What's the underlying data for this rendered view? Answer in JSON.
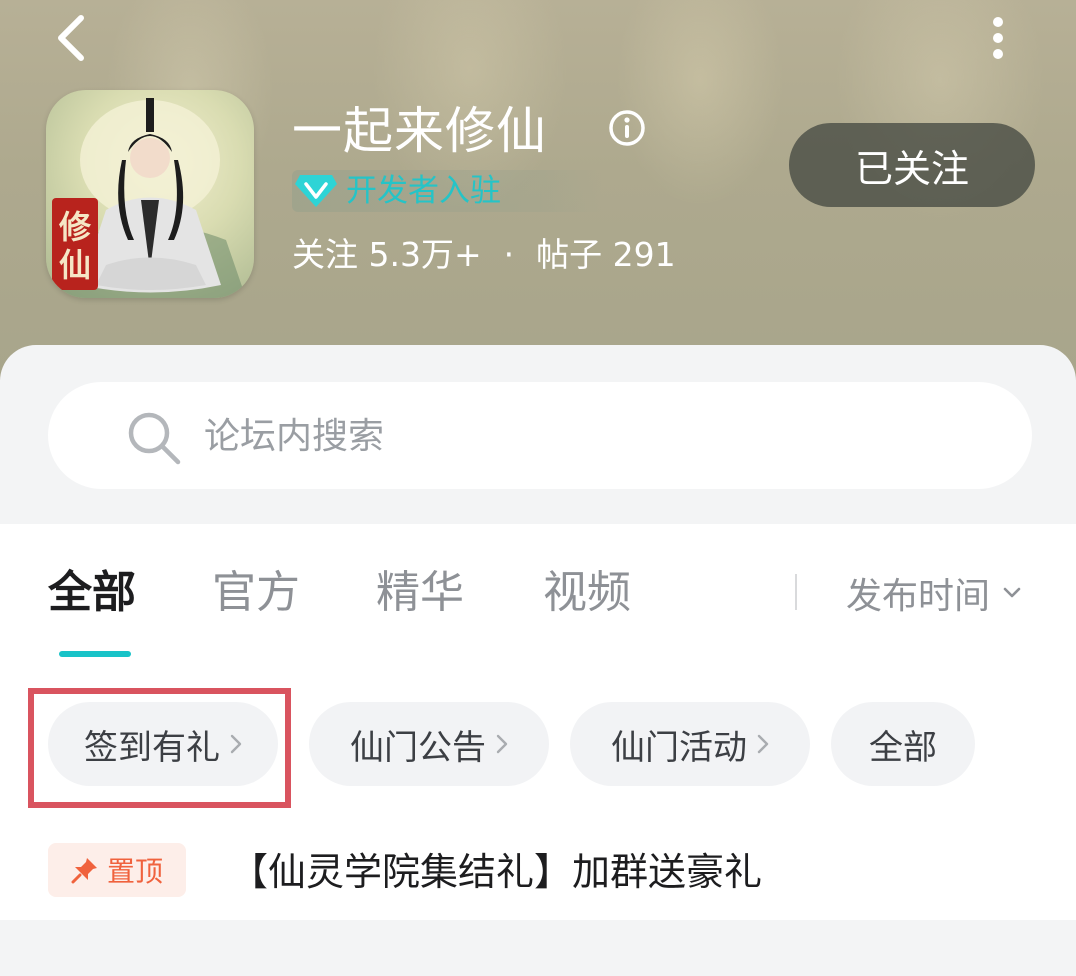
{
  "header": {
    "title": "一起来修仙",
    "developer_badge": "开发者入驻",
    "stats": {
      "followers_label": "关注 5.3万+",
      "separator": "·",
      "posts_label": "帖子 291"
    },
    "follow_button": "已关注",
    "app_icon_text": "修仙"
  },
  "search": {
    "placeholder": "论坛内搜索"
  },
  "tabs": [
    {
      "label": "全部",
      "active": true
    },
    {
      "label": "官方",
      "active": false
    },
    {
      "label": "精华",
      "active": false
    },
    {
      "label": "视频",
      "active": false
    }
  ],
  "sort": {
    "label": "发布时间"
  },
  "chips": [
    {
      "label": "签到有礼",
      "has_arrow": true
    },
    {
      "label": "仙门公告",
      "has_arrow": true
    },
    {
      "label": "仙门活动",
      "has_arrow": true
    },
    {
      "label": "全部",
      "has_arrow": false
    }
  ],
  "pinned_post": {
    "tag": "置顶",
    "title": "【仙灵学院集结礼】加群送豪礼"
  },
  "colors": {
    "accent": "#18c3c8",
    "highlight": "#d9545f",
    "pin": "#f0623d"
  },
  "icons": {
    "back": "chevron-left-icon",
    "more": "more-vertical-icon",
    "info": "info-icon",
    "badge": "diamond-icon",
    "search": "search-icon",
    "sort": "chevron-down-icon",
    "chip_arrow": "chevron-right-icon",
    "pin": "pin-icon"
  }
}
